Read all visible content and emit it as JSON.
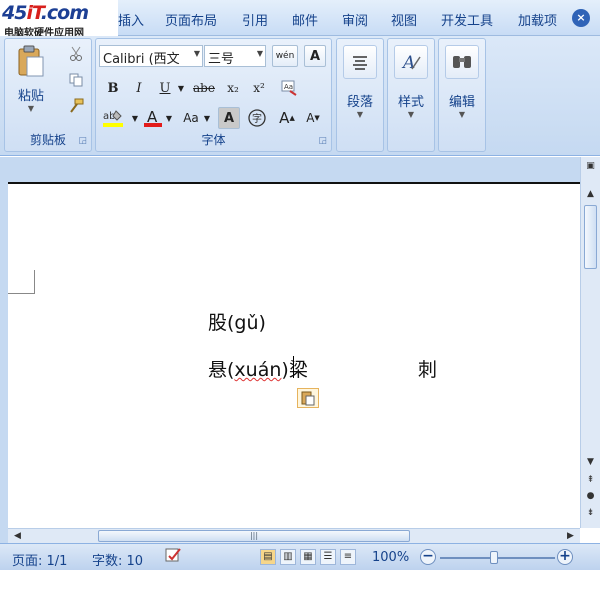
{
  "logo": {
    "main_blue": "45",
    "main_red": "iT",
    "main_tail": ".com",
    "subtitle": "电脑软硬件应用网"
  },
  "tabs": [
    "插入",
    "页面布局",
    "引用",
    "邮件",
    "审阅",
    "视图",
    "开发工具",
    "加载项"
  ],
  "close_label": "×",
  "clipboard": {
    "paste_label": "粘贴",
    "group_label": "剪贴板"
  },
  "font": {
    "font_name": "Calibri (西文",
    "font_size": "三号",
    "bold": "B",
    "italic": "I",
    "underline": "U",
    "strike": "abe",
    "subscript": "x₂",
    "superscript": "x²",
    "case": "Aa",
    "grow": "A",
    "shrink": "A",
    "group_label": "字体"
  },
  "paragraph": {
    "label": "段落"
  },
  "styles": {
    "label": "样式"
  },
  "editing": {
    "label": "编辑"
  },
  "document": {
    "line1": "股(gǔ)",
    "line2_prefix": "悬(",
    "line2_pinyin": "xuán",
    "line2_suffix": ")梁",
    "line2_far": "刺"
  },
  "status": {
    "page": "页面: 1/1",
    "words": "字数: 10",
    "zoom": "100%"
  },
  "colors": {
    "accent": "#15428b",
    "ribbon_bg": "#c5d9f1",
    "highlight": "#ffff00",
    "font_color": "#e21b1b"
  }
}
